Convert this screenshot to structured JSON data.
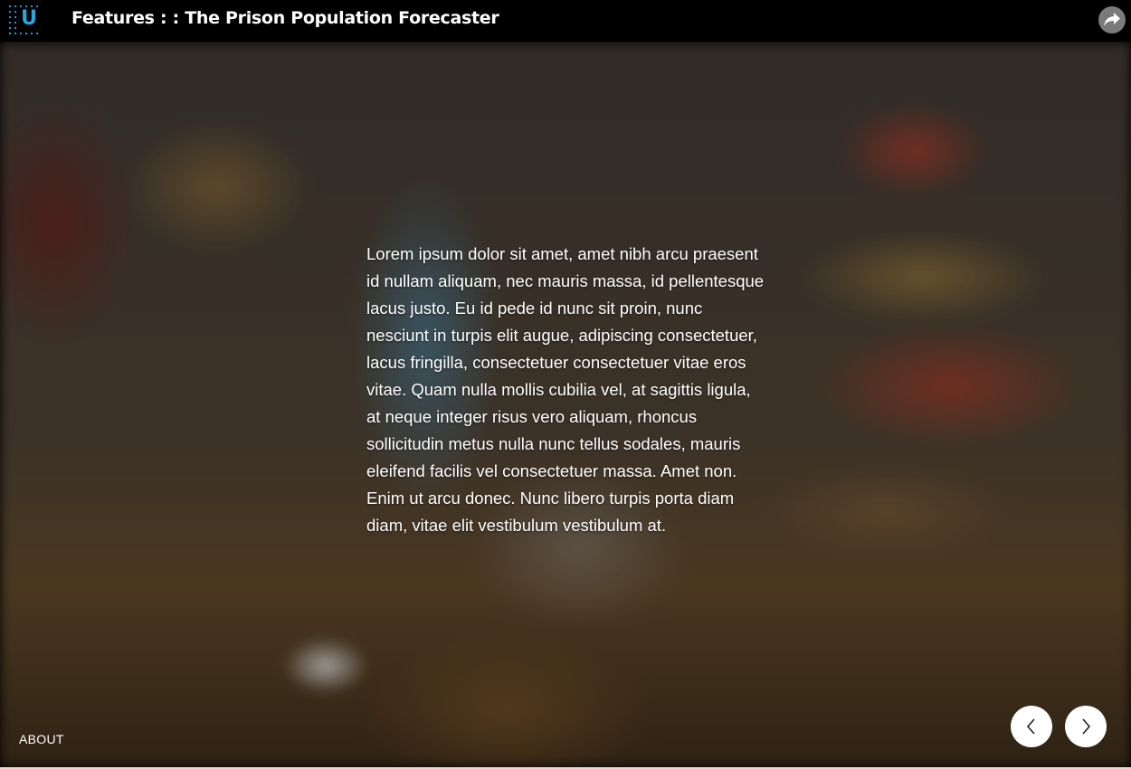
{
  "header": {
    "logo_letter": "U",
    "title": "Features : : The Prison Population Forecaster",
    "share_icon": "share-arrow-icon"
  },
  "main": {
    "background": "blurred-photo-pantry",
    "body_text": "Lorem ipsum dolor sit amet, amet nibh arcu praesent id nullam aliquam, nec mauris massa, id pellentesque lacus justo. Eu id pede id nunc sit proin, nunc nesciunt in turpis elit augue, adipiscing consectetuer, lacus fringilla, consectetuer consectetuer vitae eros vitae. Quam nulla mollis cubilia vel, at sagittis ligula, at neque integer risus vero aliquam, rhoncus sollicitudin metus nulla nunc tellus sodales, mauris eleifend facilis vel consectetuer massa. Amet non. Enim ut arcu donec. Nunc libero turpis porta diam diam, vitae elit vestibulum vestibulum at."
  },
  "footer": {
    "about_label": "ABOUT",
    "prev_icon": "chevron-left-icon",
    "next_icon": "chevron-right-icon"
  },
  "colors": {
    "logo_accent": "#29a8e0",
    "topbar": "#000000",
    "share_button": "#7a7a7a",
    "nav_button": "#ffffff"
  }
}
